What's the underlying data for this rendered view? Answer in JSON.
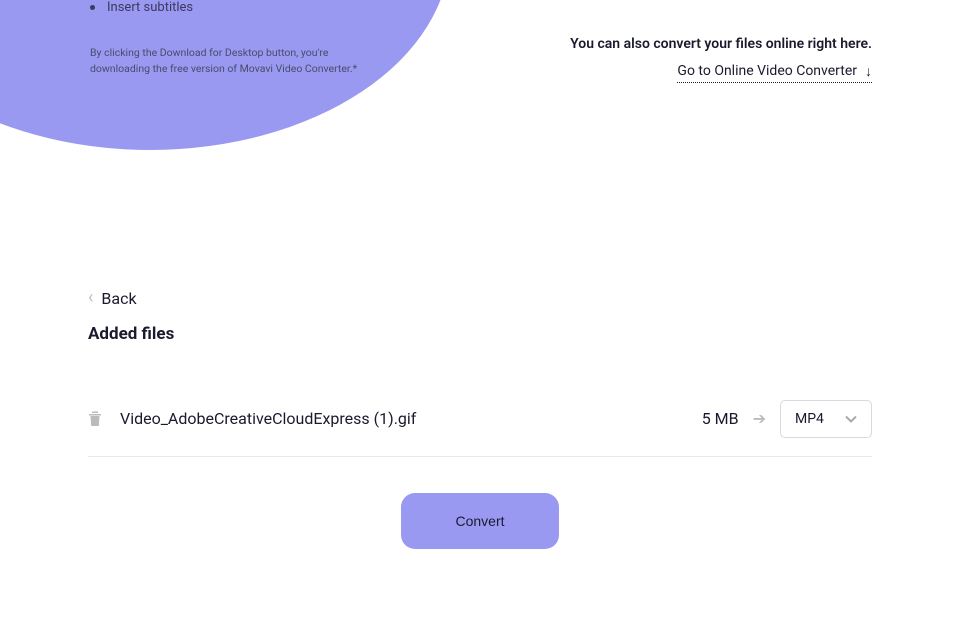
{
  "hero": {
    "bullet": "Insert subtitles",
    "disclaimer_line1": "By clicking the Download for Desktop button, you're",
    "disclaimer_line2": "downloading the free version of Movavi Video Converter.*"
  },
  "online": {
    "text": "You can also convert your files online right here.",
    "link": "Go to Online Video Converter"
  },
  "main": {
    "back": "Back",
    "heading": "Added files",
    "file": {
      "name": "Video_AdobeCreativeCloudExpress (1).gif",
      "size": "5 MB",
      "format": "MP4"
    },
    "convert": "Convert"
  }
}
